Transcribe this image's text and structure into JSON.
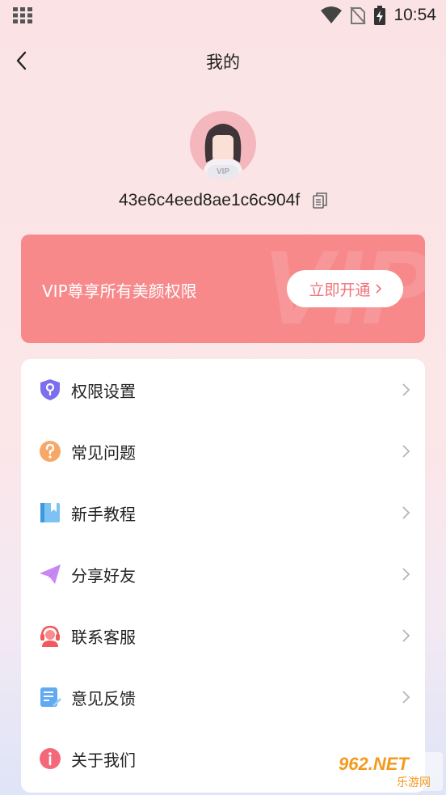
{
  "status_bar": {
    "time": "10:54"
  },
  "nav": {
    "title": "我的"
  },
  "profile": {
    "avatar_badge": "VIP",
    "user_id": "43e6c4eed8ae1c6c904f"
  },
  "vip_banner": {
    "text": "VIP尊享所有美颜权限",
    "button_label": "立即开通",
    "watermark": "VIP"
  },
  "menu": {
    "items": [
      {
        "label": "权限设置",
        "icon": "shield-key-icon"
      },
      {
        "label": "常见问题",
        "icon": "question-circle-icon"
      },
      {
        "label": "新手教程",
        "icon": "book-icon"
      },
      {
        "label": "分享好友",
        "icon": "paper-plane-icon"
      },
      {
        "label": "联系客服",
        "icon": "headset-agent-icon"
      },
      {
        "label": "意见反馈",
        "icon": "feedback-note-icon"
      },
      {
        "label": "关于我们",
        "icon": "info-circle-icon"
      }
    ]
  },
  "site_watermark": {
    "top": "962.NET",
    "bottom": "乐游网"
  },
  "colors": {
    "accent": "#f7898b",
    "button_text": "#f07378"
  }
}
